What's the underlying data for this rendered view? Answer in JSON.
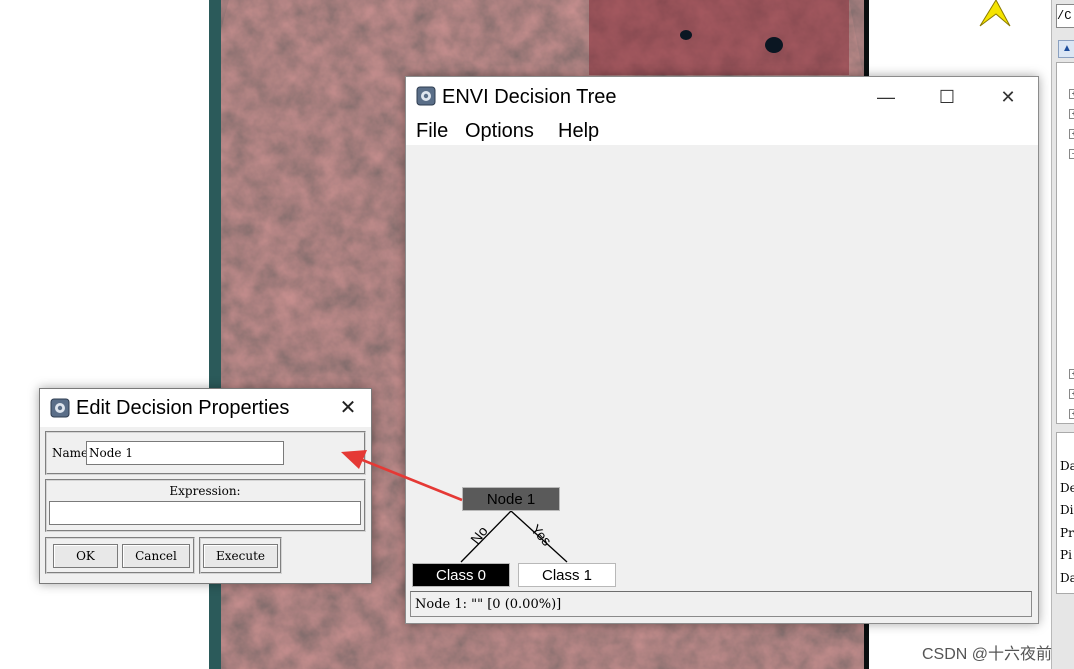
{
  "dt_window": {
    "title": "ENVI Decision Tree",
    "menu": [
      "File",
      "Options",
      "Help"
    ],
    "nodes": {
      "root": "Node 1",
      "left": "Class 0",
      "right": "Class 1",
      "branch_no": "No",
      "branch_yes": "Yes"
    },
    "status": "Node 1: \"\" [0 (0.00%)]"
  },
  "edit_dialog": {
    "title": "Edit Decision Properties",
    "name_label": "Name",
    "name_value": "Node 1",
    "expression_label": "Expression:",
    "expression_value": "",
    "ok_label": "OK",
    "cancel_label": "Cancel",
    "execute_label": "Execute"
  },
  "right_panel": {
    "path": "/C",
    "labels": [
      "Da",
      "De",
      "Di",
      "Pr",
      "Pi",
      "Da"
    ]
  },
  "watermark": "CSDN @十六夜前",
  "colors": {
    "accent_arrow": "#e53935",
    "north_arrow": "#f5e400",
    "node_fill": "#5a5a5a"
  }
}
